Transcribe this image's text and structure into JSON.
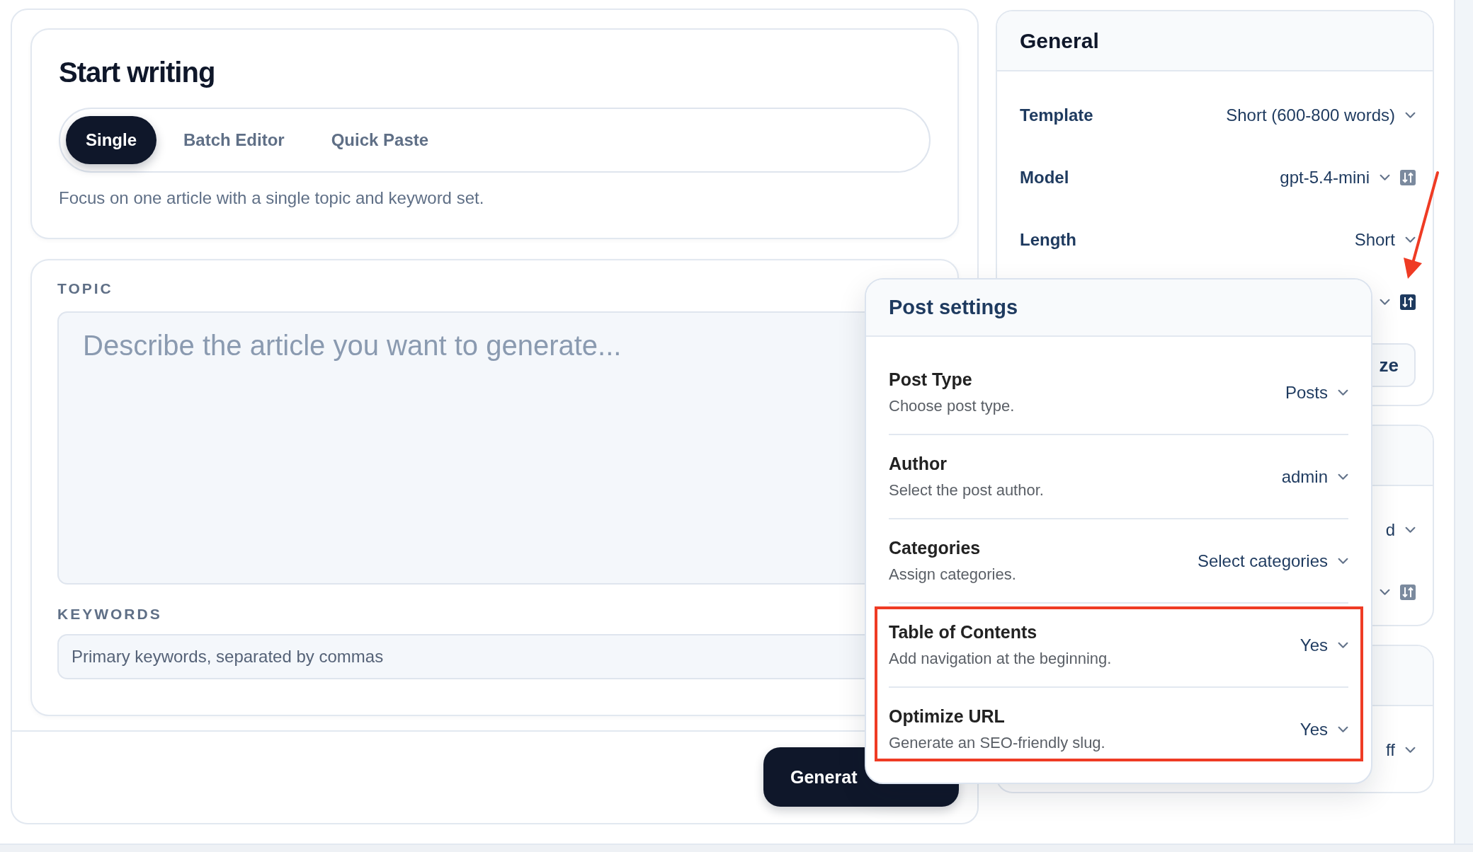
{
  "start_writing": {
    "title": "Start writing",
    "tabs": [
      {
        "label": "Single",
        "selected": true
      },
      {
        "label": "Batch Editor",
        "selected": false
      },
      {
        "label": "Quick Paste",
        "selected": false
      }
    ],
    "description": "Focus on one article with a single topic and keyword set."
  },
  "topic": {
    "label": "TOPIC",
    "placeholder": "Describe the article you want to generate..."
  },
  "keywords": {
    "label": "KEYWORDS",
    "placeholder": "Primary keywords, separated by commas"
  },
  "generate_button": {
    "label": "Generat"
  },
  "general": {
    "title": "General",
    "rows": [
      {
        "kind": "select",
        "label": "Template",
        "value": "Short (600-800 words)"
      },
      {
        "kind": "select_tune",
        "label": "Model",
        "value": "gpt-5.4-mini",
        "tune_active": false
      },
      {
        "kind": "select",
        "label": "Length",
        "value": "Short"
      },
      {
        "kind": "select_tune",
        "tune_active": true
      }
    ],
    "button": "ze"
  },
  "card_2": {
    "rows": [
      {
        "kind": "select",
        "value": "d"
      },
      {
        "kind": "select_tune",
        "tune_active": false
      }
    ]
  },
  "card_3": {
    "rows": [
      {
        "kind": "select",
        "value": "ff"
      }
    ]
  },
  "post_settings": {
    "title": "Post settings",
    "rows": [
      {
        "label": "Post Type",
        "description": "Choose post type.",
        "value": "Posts"
      },
      {
        "label": "Author",
        "description": "Select the post author.",
        "value": "admin"
      },
      {
        "label": "Categories",
        "description": "Assign categories.",
        "value": "Select categories"
      },
      {
        "label": "Table of Contents",
        "description": "Add navigation at the beginning.",
        "value": "Yes"
      },
      {
        "label": "Optimize URL",
        "description": "Generate an SEO-friendly slug.",
        "value": "Yes"
      }
    ]
  }
}
